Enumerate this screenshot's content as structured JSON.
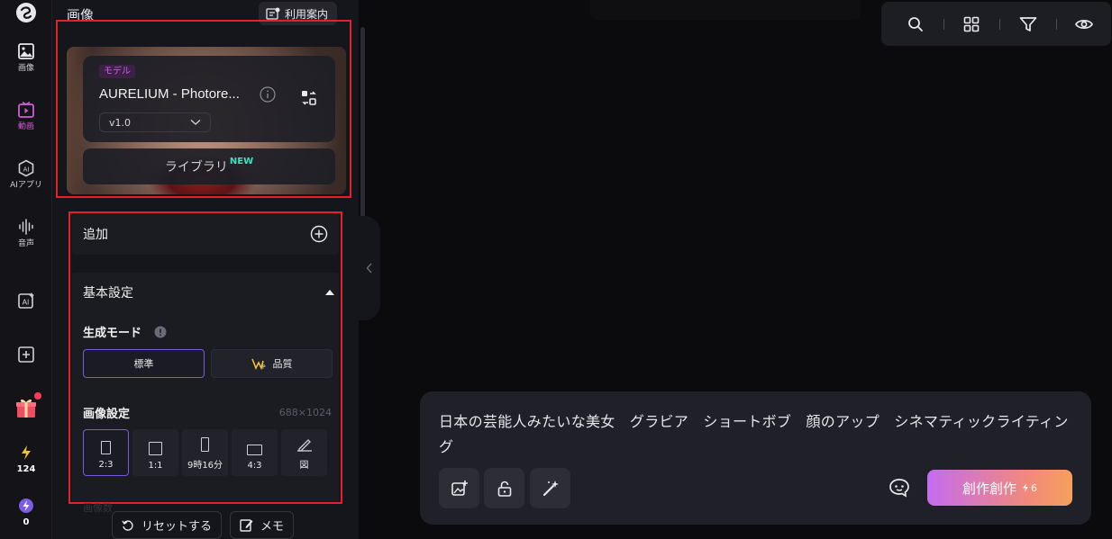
{
  "rail": {
    "items": [
      {
        "label": "画像"
      },
      {
        "label": "動画"
      },
      {
        "label": "AIアプリ"
      },
      {
        "label": "音声"
      }
    ],
    "bolt_count": "124",
    "star_count": "0"
  },
  "panel": {
    "title": "画像",
    "guide_label": "利用案内",
    "model": {
      "tag": "モデル",
      "name": "AURELIUM - Photore...",
      "version": "v1.0",
      "library_label": "ライブラリ",
      "library_badge": "NEW"
    },
    "add_label": "追加",
    "basic_settings_label": "基本設定",
    "generation_mode_label": "生成モード",
    "modes": [
      {
        "label": "標準",
        "active": true
      },
      {
        "label": "品質",
        "active": false
      }
    ],
    "image_settings_label": "画像設定",
    "image_size": "688×1024",
    "ratios": [
      {
        "label": "2:3",
        "active": true
      },
      {
        "label": "1:1",
        "active": false
      },
      {
        "label": "9時16分",
        "active": false
      },
      {
        "label": "4:3",
        "active": false
      },
      {
        "label": "図",
        "active": false
      }
    ],
    "faded_label": "画像数",
    "reset_label": "リセットする",
    "memo_label": "メモ"
  },
  "toolbar": {
    "icons": [
      "search-icon",
      "grid-icon",
      "filter-icon",
      "eye-icon"
    ]
  },
  "prompt": {
    "text": "日本の芸能人みたいな美女　グラビア　ショートボブ　顔のアップ　シネマティックライティング",
    "create_label": "創作創作",
    "cost": "6"
  },
  "colors": {
    "accent_purple": "#7a5ad8",
    "highlight_red": "#e0232b",
    "new_badge": "#3ee0c0",
    "create_gradient_start": "#c56cf0",
    "create_gradient_end": "#f5a05c"
  }
}
